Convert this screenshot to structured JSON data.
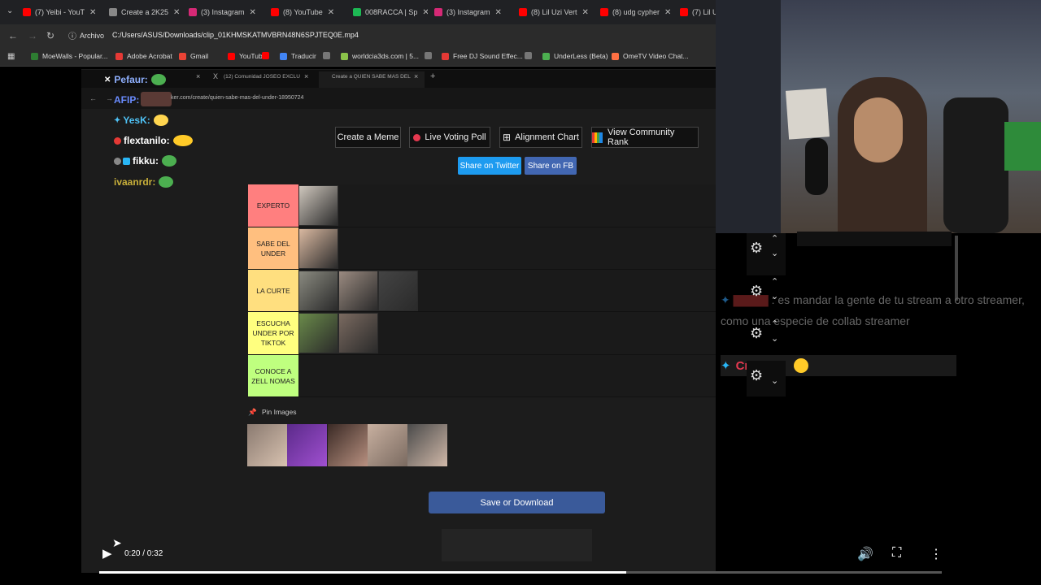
{
  "outer_tabs": [
    {
      "label": "(7) Yeibi - YouT",
      "color": "#ff0000"
    },
    {
      "label": "Create a 2K25",
      "color": "#888888"
    },
    {
      "label": "(3) Instagram",
      "color": "#d62976"
    },
    {
      "label": "(8) YouTube",
      "color": "#ff0000"
    },
    {
      "label": "008RACCA | Sp",
      "color": "#1db954"
    },
    {
      "label": "(3) Instagram",
      "color": "#d62976"
    },
    {
      "label": "(8) Lil Uzi Vert",
      "color": "#ff0000"
    },
    {
      "label": "(8) udg cypher",
      "color": "#ff0000"
    },
    {
      "label": "(7) Lil U",
      "color": "#ff0000"
    }
  ],
  "address": {
    "badge": "Archivo",
    "path": "C:/Users/ASUS/Downloads/clip_01KHMSKATMVBRN48N6SPJTEQ0E.mp4"
  },
  "bookmarks": [
    {
      "label": "MoeWalls - Popular...",
      "color": "#2e7d32"
    },
    {
      "label": "Adobe Acrobat",
      "color": "#e53935"
    },
    {
      "label": "Gmail",
      "color": "#ea4335"
    },
    {
      "label": "YouTube",
      "color": "#ff0000"
    },
    {
      "label": "",
      "color": "#ff0000"
    },
    {
      "label": "Traducir",
      "color": "#4285f4"
    },
    {
      "label": "",
      "color": "#777777"
    },
    {
      "label": "worldcia3ds.com | 5...",
      "color": "#8bc34a"
    },
    {
      "label": "",
      "color": "#777777"
    },
    {
      "label": "Free DJ Sound Effec...",
      "color": "#e53935"
    },
    {
      "label": "",
      "color": "#777777"
    },
    {
      "label": "UnderLess (Beta)",
      "color": "#4caf50"
    },
    {
      "label": "OmeTV Video Chat...",
      "color": "#ff7043"
    }
  ],
  "inner_tabs": [
    {
      "label": "(12) Comunidad JOSEO EXCLU"
    },
    {
      "label": "Create a QUIEN SABE MAS DEL"
    }
  ],
  "inner_url": "ker.com/create/quien-sabe-mas-del-under-18950724",
  "chat_left": [
    {
      "name": "Pefaur:",
      "color": "#8fb0ff"
    },
    {
      "name": "AFIP:",
      "color": "#6a8cff"
    },
    {
      "name": "YesK:",
      "color": "#4fc3f7"
    },
    {
      "name": "flextanilo:",
      "color": "#ffffff"
    },
    {
      "name": "fikku:",
      "color": "#ffffff"
    },
    {
      "name": "ivaanrdr:",
      "color": "#c9b03a"
    }
  ],
  "toolbar": {
    "create_meme": "Create a Meme",
    "live_poll": "Live Voting Poll",
    "alignment": "Alignment Chart",
    "community": "View Community Rank",
    "share_twitter": "Share on Twitter",
    "share_fb": "Share on FB"
  },
  "tiers": [
    {
      "label": "EXPERTO",
      "color": "#ff7f7f",
      "items": 1
    },
    {
      "label": "SABE DEL UNDER",
      "color": "#ffbf7f",
      "items": 1
    },
    {
      "label": "LA CURTE",
      "color": "#ffdf7f",
      "items": 3
    },
    {
      "label": "ESCUCHA UNDER POR TIKTOK",
      "color": "#ffff7f",
      "items": 2
    },
    {
      "label": "CONOCE A ZELL NOMAS",
      "color": "#bfff7f",
      "items": 0
    }
  ],
  "pin_label": "Pin Images",
  "save_label": "Save or Download",
  "right_chat": {
    "msg1": ": es mandar la gente de tu stream a otro streamer, como una especie de collab streamer",
    "name2": "Creyko",
    "msg2": ":"
  },
  "player": {
    "time": "0:20 / 0:32",
    "progress": 0.625
  }
}
